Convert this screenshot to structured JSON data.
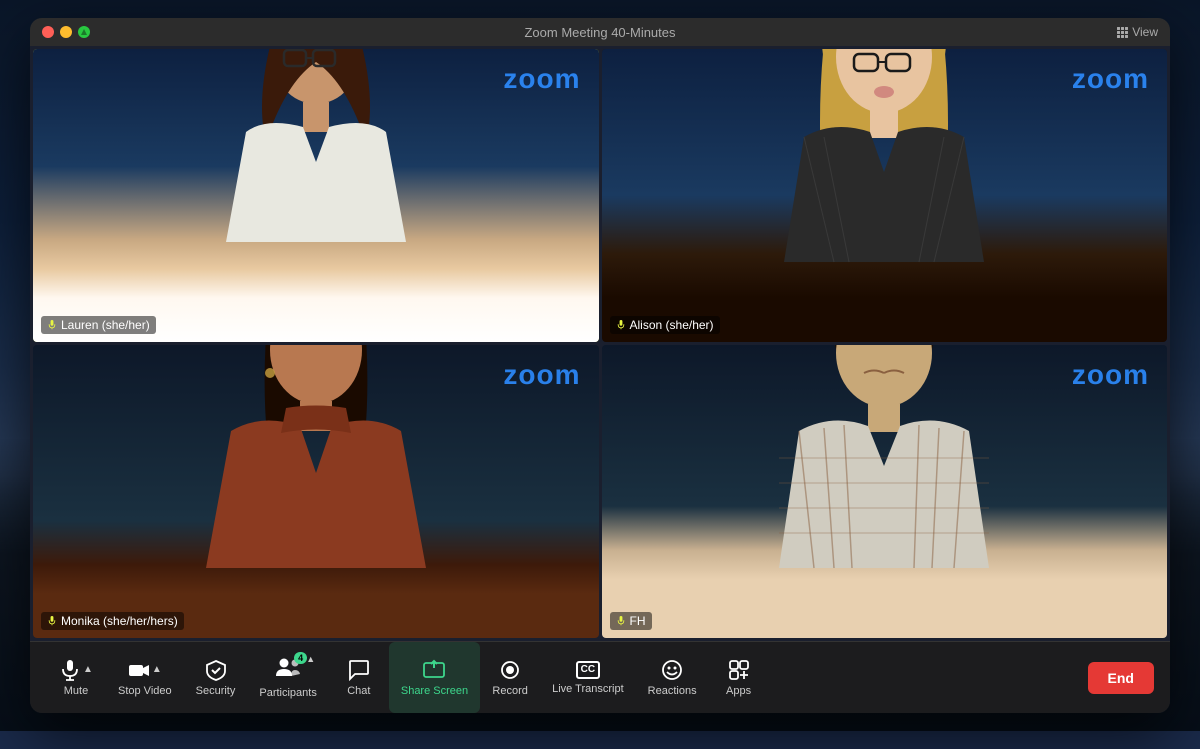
{
  "window": {
    "title": "Zoom Meeting  40-Minutes",
    "view_label": "View"
  },
  "participants": [
    {
      "id": "lauren",
      "name": "Lauren (she/her)",
      "active_speaker": true,
      "cell_index": 0,
      "zoom_watermark": "zoom",
      "muted": false
    },
    {
      "id": "alison",
      "name": "Alison (she/her)",
      "active_speaker": false,
      "cell_index": 1,
      "zoom_watermark": "zoom",
      "muted": false
    },
    {
      "id": "monika",
      "name": "Monika (she/her/hers)",
      "active_speaker": false,
      "cell_index": 2,
      "zoom_watermark": "zoom",
      "muted": false
    },
    {
      "id": "fh",
      "name": "FH",
      "active_speaker": false,
      "cell_index": 3,
      "zoom_watermark": "zoom",
      "muted": false
    }
  ],
  "toolbar": {
    "mute_label": "Mute",
    "stop_video_label": "Stop Video",
    "security_label": "Security",
    "participants_label": "Participants",
    "participants_count": "4",
    "chat_label": "Chat",
    "share_screen_label": "Share Screen",
    "record_label": "Record",
    "live_transcript_label": "Live Transcript",
    "reactions_label": "Reactions",
    "apps_label": "Apps",
    "end_label": "End"
  }
}
